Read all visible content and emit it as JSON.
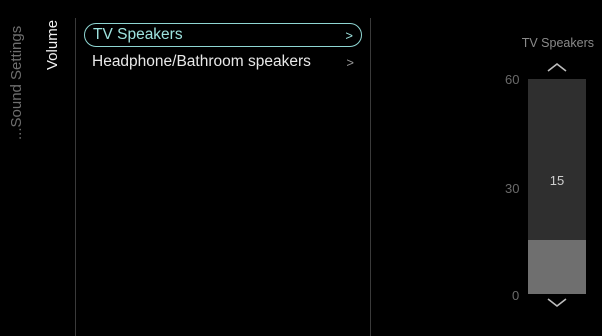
{
  "breadcrumb": {
    "label": "...Sound Settings"
  },
  "section": {
    "label": "Volume"
  },
  "menu": {
    "items": [
      {
        "label": "TV Speakers",
        "selected": true,
        "icon": "chevron-right-icon"
      },
      {
        "label": "Headphone/Bathroom speakers",
        "selected": false,
        "icon": "chevron-right-icon"
      }
    ]
  },
  "slider": {
    "title": "TV Speakers",
    "max_label": "60",
    "mid_label": "30",
    "min_label": "0",
    "value": "15",
    "value_fraction": 0.25,
    "up_icon": "chevron-up-icon",
    "down_icon": "chevron-down-icon"
  },
  "colors": {
    "accent": "#8fd6d3",
    "background": "#000000"
  }
}
